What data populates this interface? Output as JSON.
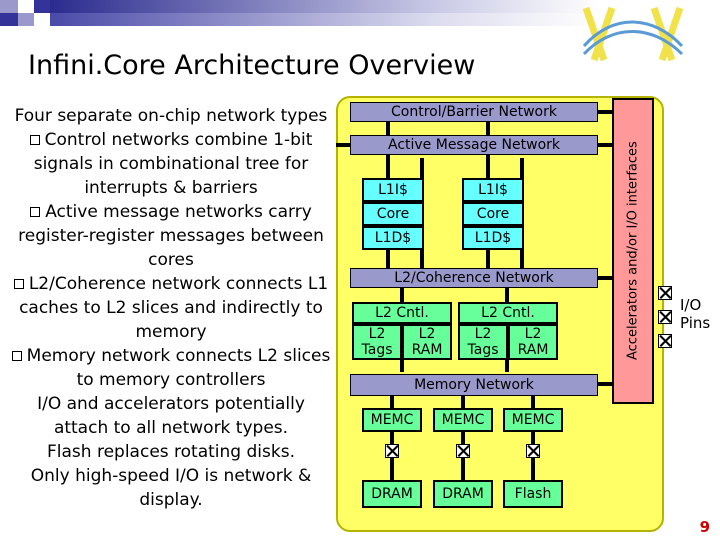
{
  "slide": {
    "title": "Infini.Core Architecture Overview",
    "page_number": "9",
    "logo_name": "infinicore-logo"
  },
  "left_panel": {
    "intro": "Four separate on-chip network types",
    "bullets": [
      "Control networks combine 1-bit signals in combinational tree for interrupts & barriers",
      "Active message networks carry register-register messages between cores",
      "L2/Coherence network connects L1 caches to L2 slices and indirectly to memory",
      "Memory network connects L2 slices to memory controllers"
    ],
    "closing": [
      "I/O and accelerators potentially attach to all network types.",
      "Flash replaces rotating disks.",
      "Only high-speed I/O is network & display."
    ]
  },
  "diagram": {
    "networks": [
      {
        "label": "Control/Barrier Network"
      },
      {
        "label": "Active Message Network"
      },
      {
        "label": "L2/Coherence Network"
      },
      {
        "label": "Memory Network"
      }
    ],
    "tiles": [
      {
        "icache": "L1I$",
        "core": "Core",
        "dcache": "L1D$"
      },
      {
        "icache": "L1I$",
        "core": "Core",
        "dcache": "L1D$"
      }
    ],
    "l2_blocks": [
      {
        "cntl": "L2 Cntl.",
        "tags": "L2 Tags",
        "ram": "L2 RAM"
      },
      {
        "cntl": "L2 Cntl.",
        "tags": "L2 Tags",
        "ram": "L2 RAM"
      }
    ],
    "memc": [
      "MEMC",
      "MEMC",
      "MEMC"
    ],
    "storage": [
      "DRAM",
      "DRAM",
      "Flash"
    ],
    "accelerator_bar": "Accelerators and/or I/O interfaces",
    "io_pins_label": "I/O\nPins",
    "io_pins_line1": "I/O",
    "io_pins_line2": "Pins"
  },
  "colors": {
    "chip_fill": "#ffff66",
    "network_bar": "#9999cc",
    "cache": "#66ffff",
    "memory_green": "#66ff99",
    "accel_pink": "#ff9999",
    "page_number": "#cc0000"
  }
}
